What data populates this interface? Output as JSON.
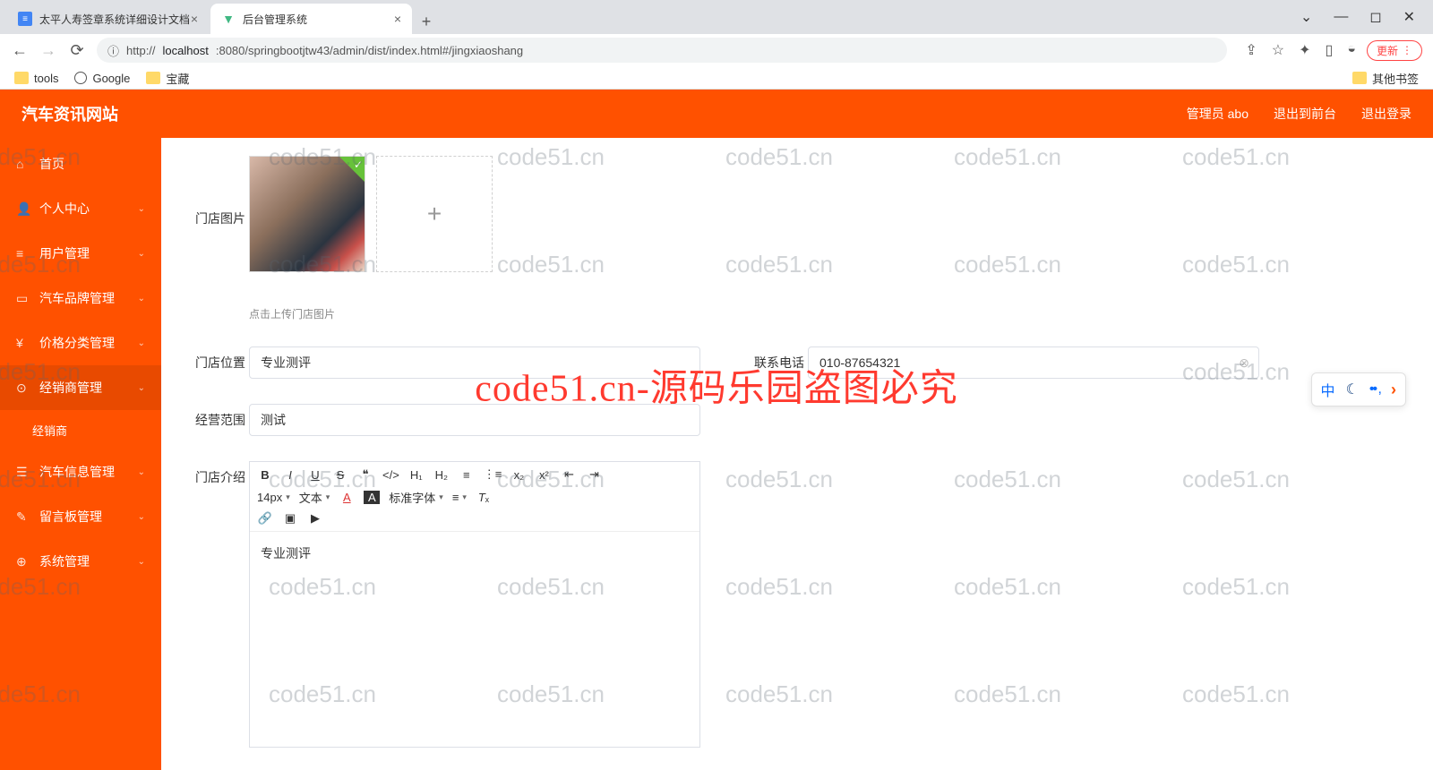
{
  "browser": {
    "tabs": [
      {
        "title": "太平人寿签章系统详细设计文档"
      },
      {
        "title": "后台管理系统"
      }
    ],
    "url_prefix": "http://",
    "url_host": "localhost",
    "url_path": ":8080/springbootjtw43/admin/dist/index.html#/jingxiaoshang",
    "update": "更新",
    "bookmarks": {
      "tools": "tools",
      "google": "Google",
      "baozang": "宝藏",
      "other": "其他书签"
    },
    "win": {
      "min": "—",
      "max": "◻",
      "close": "✕",
      "drop": "⌄"
    }
  },
  "header": {
    "title": "汽车资讯网站",
    "admin": "管理员 abo",
    "frontend": "退出到前台",
    "logout": "退出登录"
  },
  "sidebar": {
    "items": [
      {
        "icon": "⌂",
        "label": "首页"
      },
      {
        "icon": "👤",
        "label": "个人中心"
      },
      {
        "icon": "≡",
        "label": "用户管理"
      },
      {
        "icon": "▭",
        "label": "汽车品牌管理"
      },
      {
        "icon": "¥",
        "label": "价格分类管理"
      },
      {
        "icon": "⊙",
        "label": "经销商管理"
      },
      {
        "icon": "",
        "label": "经销商",
        "sub": true
      },
      {
        "icon": "☰",
        "label": "汽车信息管理"
      },
      {
        "icon": "✎",
        "label": "留言板管理"
      },
      {
        "icon": "⊕",
        "label": "系统管理"
      }
    ]
  },
  "form": {
    "imgLabel": "门店图片",
    "imgHint": "点击上传门店图片",
    "locLabel": "门店位置",
    "locVal": "专业测评",
    "phoneLabel": "联系电话",
    "phoneVal": "010-87654321",
    "scopeLabel": "经营范围",
    "scopeVal": "测试",
    "introLabel": "门店介绍",
    "editorBody": "专业测评"
  },
  "editor": {
    "fontSize": "14px",
    "paragraph": "文本",
    "fontFamily": "标准字体"
  },
  "floatTb": {
    "zh": "中",
    "dots": "•• ,"
  },
  "watermark": {
    "text": "code51.cn",
    "center": "code51.cn-源码乐园盗图必究"
  }
}
